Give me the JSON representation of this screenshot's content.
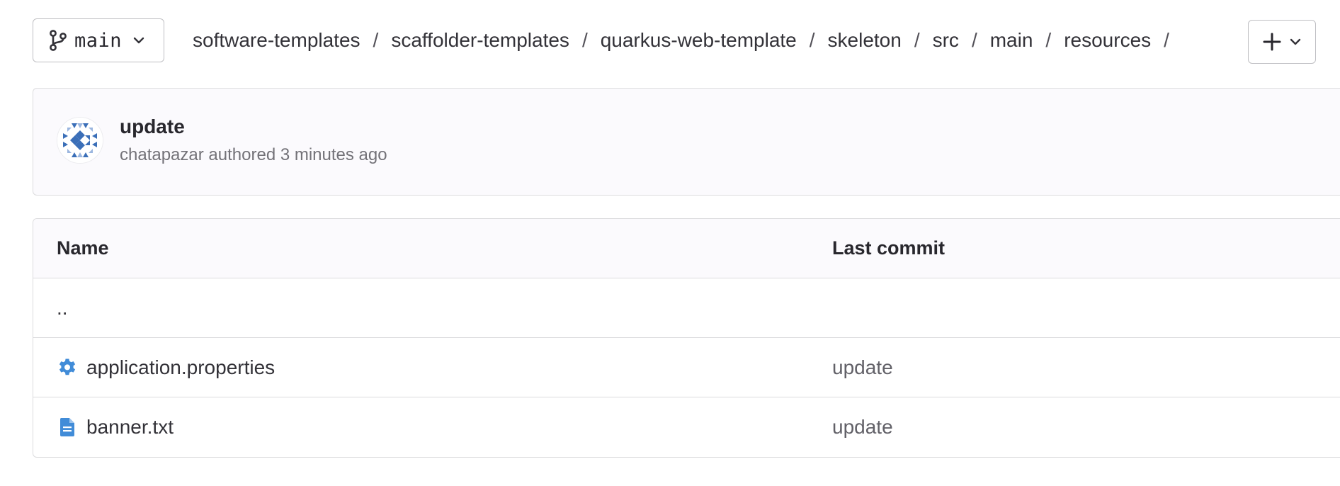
{
  "toolbar": {
    "branch": {
      "icon": "branch-icon",
      "label": "main",
      "dropdown_icon": "chevron-down-icon"
    },
    "breadcrumb": [
      "software-templates",
      "scaffolder-templates",
      "quarkus-web-template",
      "skeleton",
      "src",
      "main",
      "resources"
    ],
    "breadcrumb_separator": "/",
    "add_button": {
      "icon": "plus-icon",
      "dropdown_icon": "chevron-down-icon"
    }
  },
  "commit": {
    "title": "update",
    "meta": "chatapazar authored 3 minutes ago",
    "avatar_icon": "identicon-avatar"
  },
  "table": {
    "headers": {
      "name": "Name",
      "last_commit": "Last commit"
    },
    "parent_link": "..",
    "rows": [
      {
        "icon": "settings-file-icon",
        "name": "application.properties",
        "last_commit": "update"
      },
      {
        "icon": "text-file-icon",
        "name": "banner.txt",
        "last_commit": "update"
      }
    ]
  },
  "colors": {
    "icon_blue": "#418cd8",
    "avatar_blue": "#3b6fb8",
    "border": "#dcdcde",
    "panel_bg": "#fbfafd",
    "muted_text": "#737278"
  }
}
